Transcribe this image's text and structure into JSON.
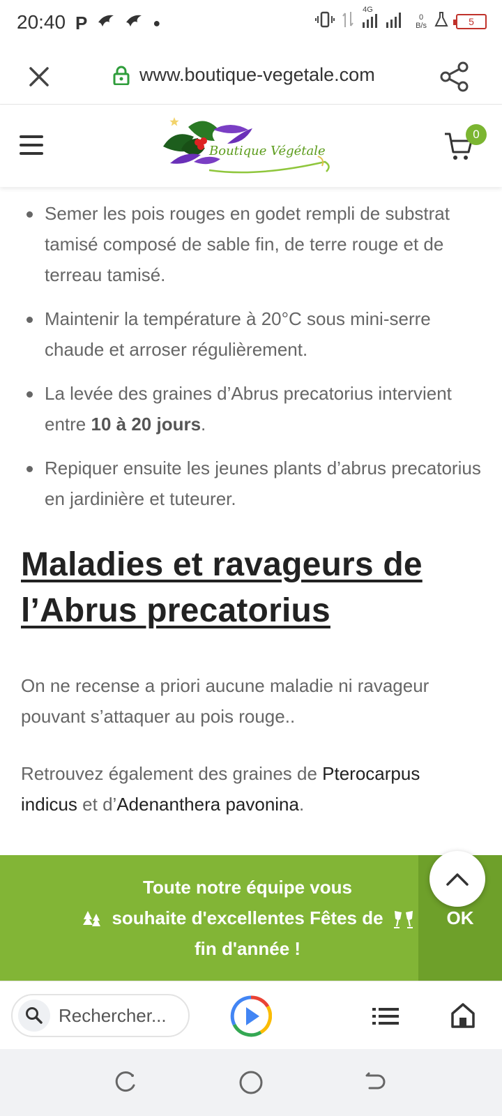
{
  "status_bar": {
    "time": "20:40",
    "network_type": "4G",
    "net_speed_value": "0",
    "net_speed_unit": "B/s",
    "battery_level": "5"
  },
  "browser": {
    "url": "www.boutique-vegetale.com"
  },
  "site_header": {
    "logo_text": "Boutique Végétale",
    "cart_count": "0"
  },
  "content": {
    "bullets": [
      {
        "text": "Semer les pois rouges en godet rempli de substrat tamisé composé de sable fin, de terre rouge et de terreau tamisé."
      },
      {
        "text": "Maintenir la température à 20°C sous mini-serre chaude et arroser régulièrement."
      },
      {
        "text_before": "La levée des graines d’Abrus precatorius intervient entre ",
        "text_bold": "10 à 20 jours",
        "text_after": "."
      },
      {
        "text": "Repiquer ensuite les jeunes plants d’abrus precatorius en jardinière et tuteurer."
      }
    ],
    "section_title": "Maladies et ravageurs de l’Abrus precatorius",
    "paragraph_1": "On ne recense a priori aucune maladie ni ravageur pouvant s’attaquer au pois rouge..",
    "paragraph_2": {
      "prefix": "Retrouvez également des graines de ",
      "link_1": "Pterocarpus indicus",
      "middle": " et d’",
      "link_2": "Adenanthera pavonina",
      "suffix": "."
    }
  },
  "banner": {
    "message": "Toute notre équipe vous souhaite d'excellentes Fêtes de fin d'année !",
    "ok_label": "OK",
    "background_color": "#82b536",
    "ok_background_color": "#6ea02a"
  },
  "bottom_bar": {
    "search_placeholder": "Rechercher..."
  }
}
